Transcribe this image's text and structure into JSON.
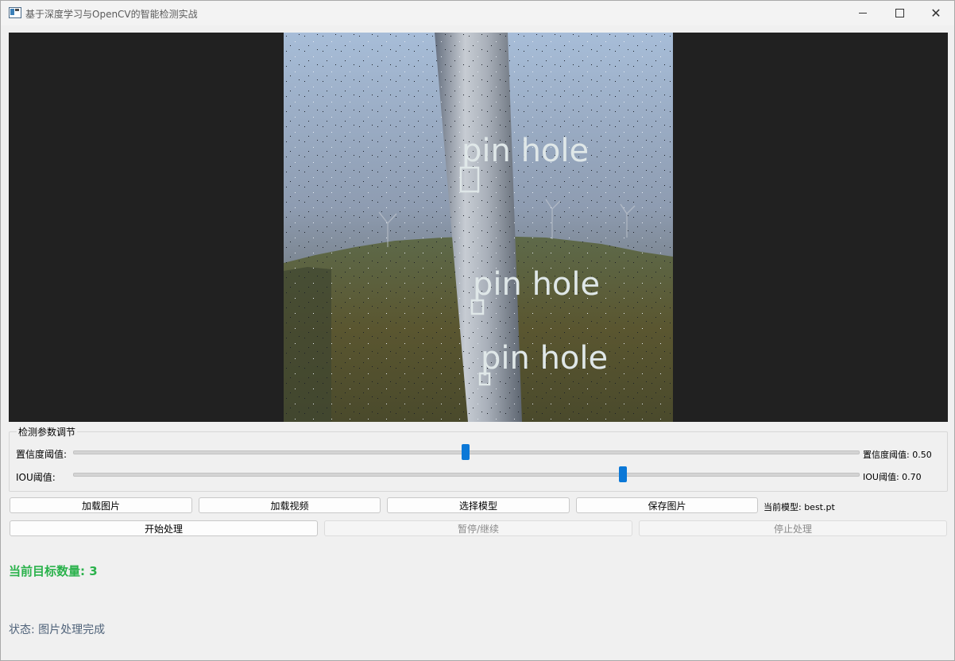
{
  "window": {
    "title": "基于深度学习与OpenCV的智能检测实战"
  },
  "image_view": {
    "detections": [
      {
        "label": "pin hole"
      },
      {
        "label": "pin hole"
      },
      {
        "label": "pin hole"
      }
    ]
  },
  "params": {
    "group_title": "检测参数调节",
    "confidence": {
      "label": "置信度阈值:",
      "value_text": "置信度阈值: 0.50",
      "value": 0.5
    },
    "iou": {
      "label": "IOU阈值:",
      "value_text": "IOU阈值: 0.70",
      "value": 0.7
    }
  },
  "toolbar": {
    "load_image": "加载图片",
    "load_video": "加载视频",
    "select_model": "选择模型",
    "save_image": "保存图片",
    "current_model": "当前模型: best.pt"
  },
  "controls": {
    "start": "开始处理",
    "pause": "暂停/继续",
    "stop": "停止处理"
  },
  "info": {
    "target_count": "当前目标数量: 3",
    "status": "状态: 图片处理完成"
  },
  "colors": {
    "accent": "#0b78d7",
    "count": "#2bb24c",
    "status": "#50637a",
    "viewer_bg": "#212121"
  }
}
